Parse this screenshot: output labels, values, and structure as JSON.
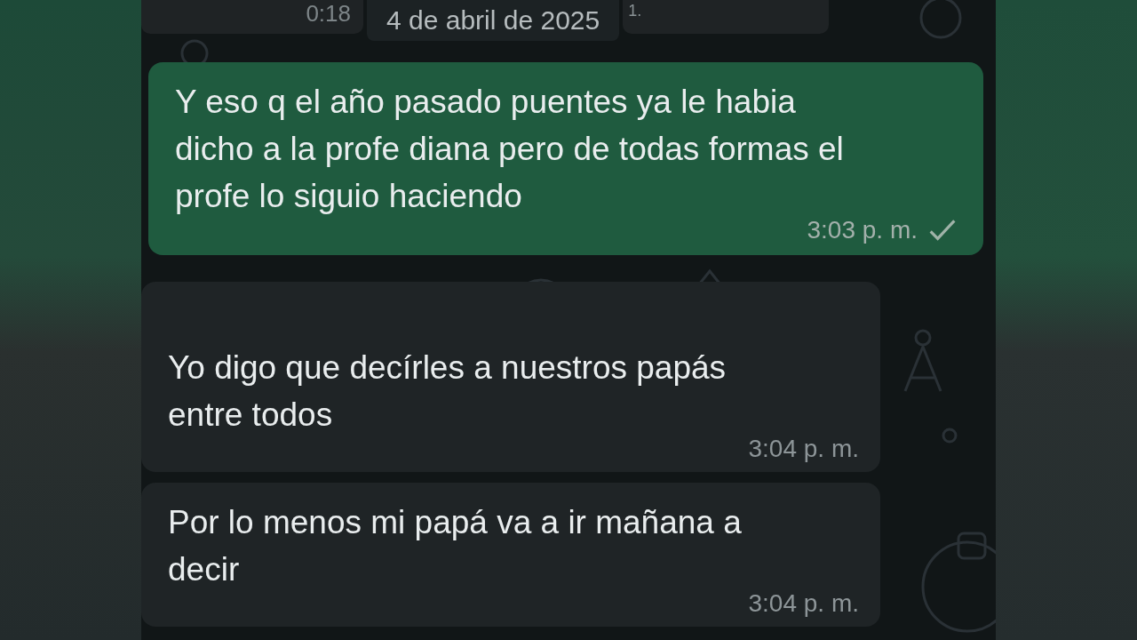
{
  "top_partial": [
    {
      "time": "0:18"
    },
    {
      "time": "1."
    }
  ],
  "date_chip": "4 de abril de 2025",
  "messages": [
    {
      "kind": "out",
      "text": "Y eso q el año pasado puentes ya le habia dicho a la profe diana pero de todas formas el profe lo siguio haciendo",
      "time": "3:03 p. m.",
      "read": false
    },
    {
      "kind": "in",
      "text": "Yo digo que decírles a nuestros papás entre todos",
      "time": "3:04 p. m."
    },
    {
      "kind": "in",
      "text": "Por lo menos mi papá va a ir mañana a decir",
      "time": "3:04 p. m."
    }
  ]
}
